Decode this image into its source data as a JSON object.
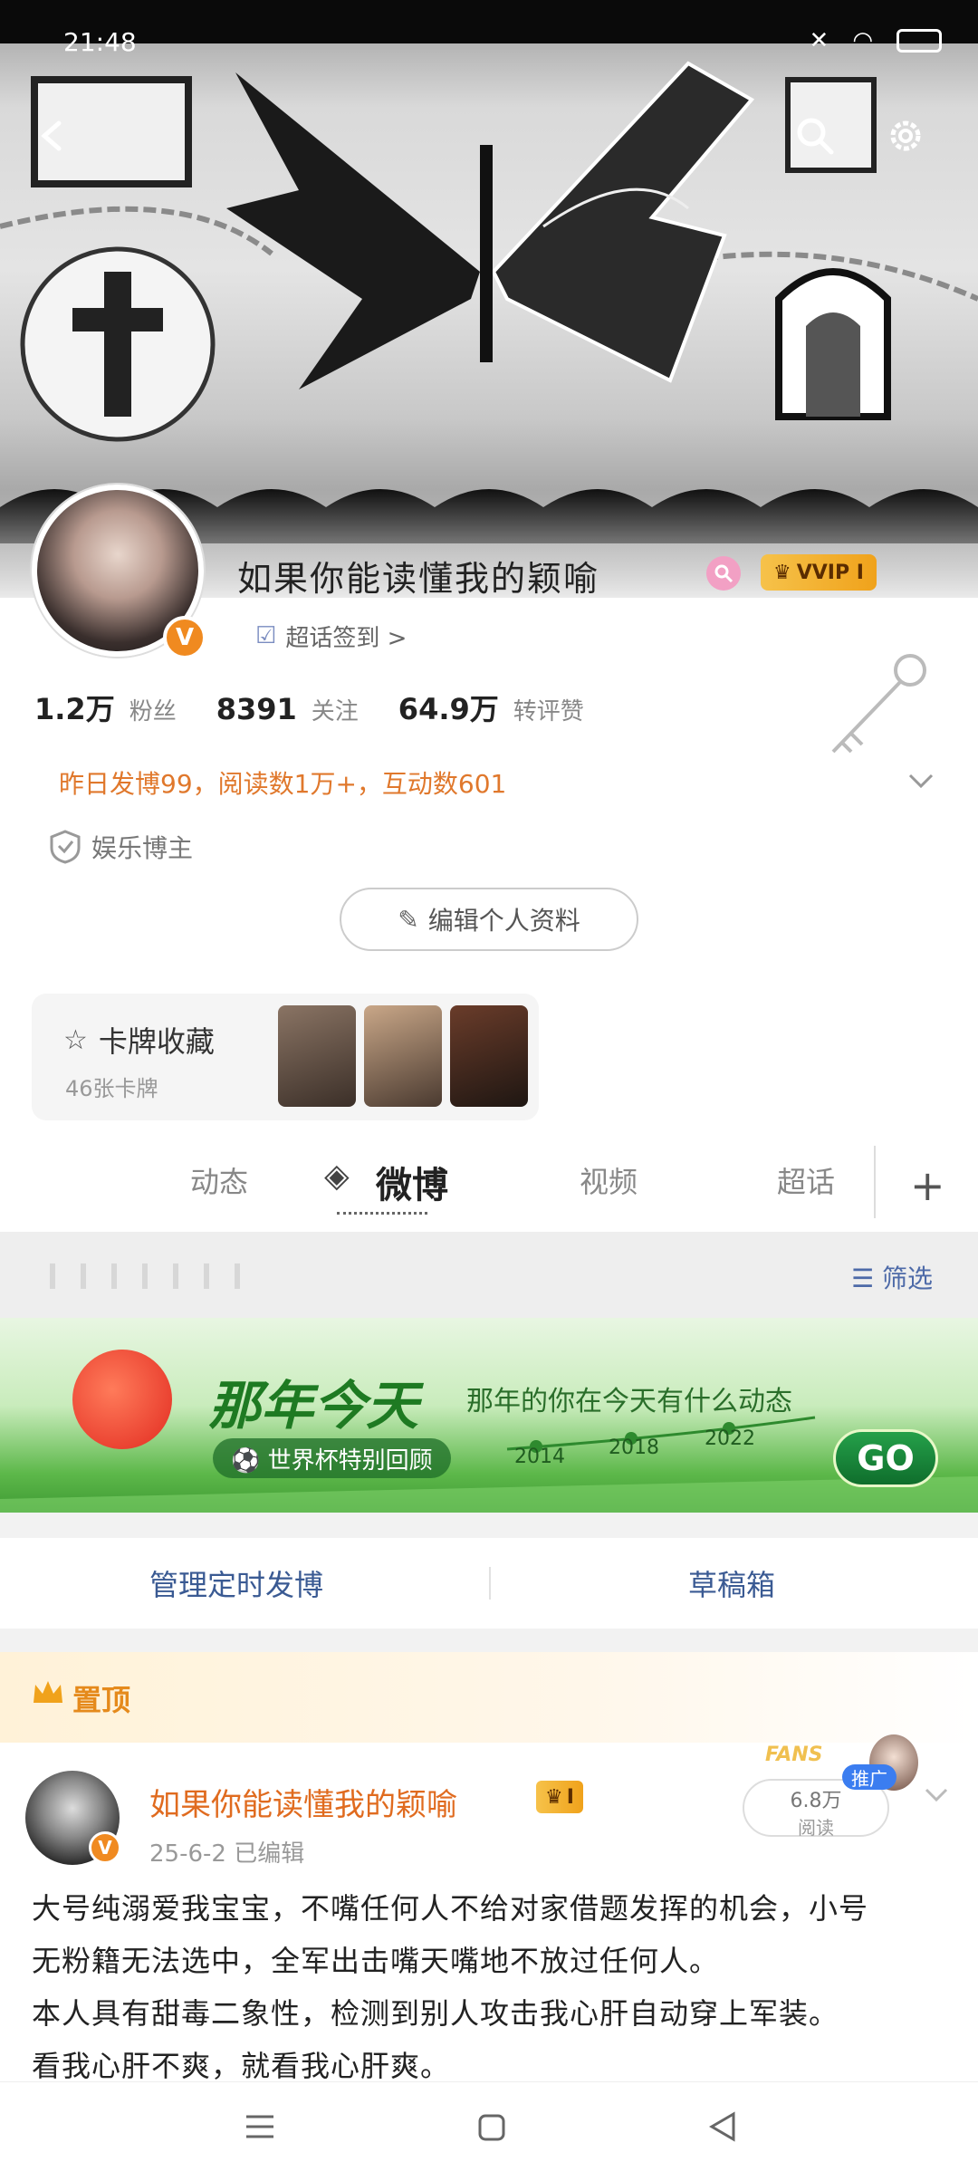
{
  "status": {
    "time": "21:48"
  },
  "profile": {
    "username": "如果你能读懂我的颖喻",
    "vip_label": "VVIP I",
    "checkin_label": "超话签到 >",
    "stats": [
      {
        "num": "1.2万",
        "label": "粉丝"
      },
      {
        "num": "8391",
        "label": "关注"
      },
      {
        "num": "64.9万",
        "label": "转评赞"
      }
    ],
    "activity": "昨日发博99，阅读数1万+，互动数601",
    "blogger_type": "娱乐博主",
    "edit_label": "编辑个人资料"
  },
  "cards": {
    "title": "卡牌收藏",
    "count": "46张卡牌"
  },
  "tabs": [
    {
      "label": "动态"
    },
    {
      "label": "微博"
    },
    {
      "label": "视频"
    },
    {
      "label": "超话"
    }
  ],
  "filter": {
    "label": "筛选"
  },
  "promo": {
    "title": "那年今天",
    "subtitle": "那年的你在今天有什么动态",
    "tag": "⚽ 世界杯特别回顾",
    "years": [
      "2014",
      "2018",
      "2022"
    ],
    "go": "GO"
  },
  "actions": {
    "manage": "管理定时发博",
    "drafts": "草稿箱"
  },
  "pinned": {
    "label": "置顶"
  },
  "post": {
    "author": "如果你能读懂我的颖喻",
    "level": "I",
    "meta": "25-6-2  已编辑",
    "reads_num": "6.8万",
    "reads_label": "阅读",
    "promo_badge": "推广",
    "fans_text": "FANS",
    "lines": [
      "大号纯溺爱我宝宝，不嘴任何人不给对家借题发挥的机会，小号",
      "无粉籍无法选中，全军出击嘴天嘴地不放过任何人。",
      "本人具有甜毒二象性，检测到别人攻击我心肝自动穿上军装。",
      "看我心肝不爽，就看我心肝爽。"
    ]
  },
  "colors": {
    "accent": "#e0782c",
    "link": "#3a5a93",
    "promo_green": "#1e7a22"
  }
}
